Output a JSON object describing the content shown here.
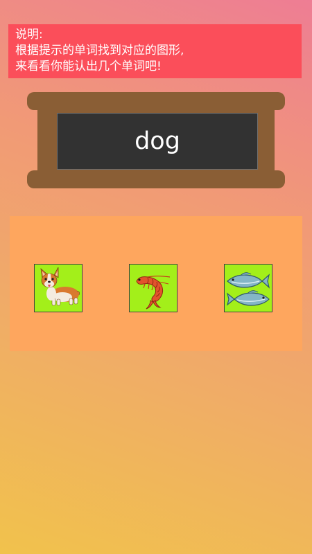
{
  "instructions": {
    "line1": "说明:",
    "line2": "根据提示的单词找到对应的图形,",
    "line3": "来看看你能认出几个单词吧!"
  },
  "board": {
    "word": "dog"
  },
  "choices": [
    {
      "icon": "corgi-dog-icon"
    },
    {
      "icon": "shrimp-icon"
    },
    {
      "icon": "fish-icon"
    }
  ],
  "colors": {
    "instructions_bg": "#fb4e5a",
    "board_wood": "#8a5e35",
    "board_screen": "#323232",
    "choices_bg": "#fea65e",
    "card_bg": "#a3ef1a"
  }
}
